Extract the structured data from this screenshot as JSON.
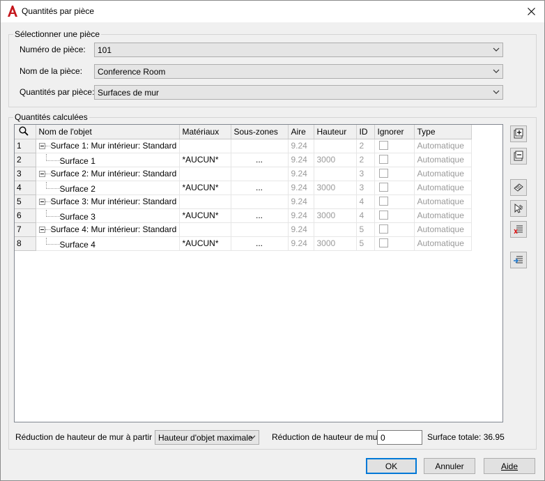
{
  "window": {
    "title": "Quantités par pièce"
  },
  "select_group": {
    "label": "Sélectionner une pièce",
    "fields": [
      {
        "label": "Numéro de pièce:",
        "value": "101"
      },
      {
        "label": "Nom de la pièce:",
        "value": "Conference Room"
      },
      {
        "label": "Quantités par pièce:",
        "value": "Surfaces de mur"
      }
    ]
  },
  "quantities_group": {
    "label": "Quantités calculées",
    "columns": [
      "Nom de l'objet",
      "Matériaux",
      "Sous-zones",
      "Aire",
      "Hauteur",
      "ID",
      "Ignorer",
      "Type"
    ],
    "rows": [
      {
        "num": "1",
        "name": "Surface 1: Mur intérieur: Standard",
        "material": "",
        "subzones": "",
        "area": "9.24",
        "height": "",
        "id": "2",
        "type": "Automatique",
        "parent": true
      },
      {
        "num": "2",
        "name": "Surface 1",
        "material": "*AUCUN*",
        "subzones": "...",
        "area": "9.24",
        "height": "3000",
        "id": "2",
        "type": "Automatique",
        "parent": false
      },
      {
        "num": "3",
        "name": "Surface 2: Mur intérieur: Standard",
        "material": "",
        "subzones": "",
        "area": "9.24",
        "height": "",
        "id": "3",
        "type": "Automatique",
        "parent": true
      },
      {
        "num": "4",
        "name": "Surface 2",
        "material": "*AUCUN*",
        "subzones": "...",
        "area": "9.24",
        "height": "3000",
        "id": "3",
        "type": "Automatique",
        "parent": false
      },
      {
        "num": "5",
        "name": "Surface 3: Mur intérieur: Standard",
        "material": "",
        "subzones": "",
        "area": "9.24",
        "height": "",
        "id": "4",
        "type": "Automatique",
        "parent": true
      },
      {
        "num": "6",
        "name": "Surface 3",
        "material": "*AUCUN*",
        "subzones": "...",
        "area": "9.24",
        "height": "3000",
        "id": "4",
        "type": "Automatique",
        "parent": false
      },
      {
        "num": "7",
        "name": "Surface 4: Mur intérieur: Standard",
        "material": "",
        "subzones": "",
        "area": "9.24",
        "height": "",
        "id": "5",
        "type": "Automatique",
        "parent": true
      },
      {
        "num": "8",
        "name": "Surface 4",
        "material": "*AUCUN*",
        "subzones": "...",
        "area": "9.24",
        "height": "3000",
        "id": "5",
        "type": "Automatique",
        "parent": false
      }
    ]
  },
  "side_buttons": [
    "expand-all-icon",
    "collapse-all-icon",
    "select-objects-icon",
    "pick-objects-icon",
    "remove-rows-icon",
    "import-rows-icon"
  ],
  "footer": {
    "reduction_from_label": "Réduction de hauteur de mur à partir de",
    "reduction_from_value": "Hauteur d'objet maximale",
    "reduction_label": "Réduction de hauteur de mur",
    "reduction_value": "0",
    "total_label": "Surface totale: 36.95"
  },
  "buttons": {
    "ok": "OK",
    "cancel": "Annuler",
    "help": "Aide"
  },
  "colors": {
    "accent": "#0078d7",
    "autocad_red": "#c4161c",
    "gray_text": "#9a9a9a"
  }
}
